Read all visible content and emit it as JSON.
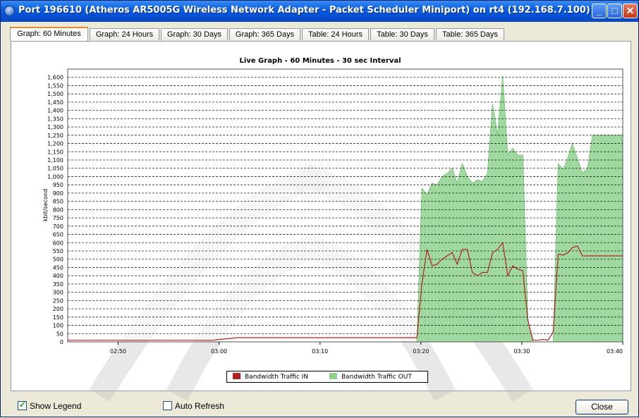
{
  "window": {
    "title": "Port 196610 (Atheros AR5005G Wireless Network Adapter - Packet Scheduler Miniport) on rt4 (192.168.7.100)"
  },
  "tabs": [
    {
      "label": "Graph: 60 Minutes",
      "active": true
    },
    {
      "label": "Graph: 24 Hours",
      "active": false
    },
    {
      "label": "Graph: 30 Days",
      "active": false
    },
    {
      "label": "Graph: 365 Days",
      "active": false
    },
    {
      "label": "Table: 24 Hours",
      "active": false
    },
    {
      "label": "Table: 30 Days",
      "active": false
    },
    {
      "label": "Table: 365 Days",
      "active": false
    }
  ],
  "chart_data": {
    "type": "area",
    "title": "Live Graph - 60 Minutes - 30 sec Interval",
    "ylabel": "kbit/second",
    "xlabel": "",
    "ylim": [
      0,
      1650
    ],
    "yticks": [
      0,
      50,
      100,
      150,
      200,
      250,
      300,
      350,
      400,
      450,
      500,
      550,
      600,
      650,
      700,
      750,
      800,
      850,
      900,
      950,
      1000,
      1050,
      1100,
      1150,
      1200,
      1250,
      1300,
      1350,
      1400,
      1450,
      1500,
      1550,
      1600
    ],
    "yticklabels": [
      "0",
      "50",
      "100",
      "150",
      "200",
      "250",
      "300",
      "350",
      "400",
      "450",
      "500",
      "550",
      "600",
      "650",
      "700",
      "750",
      "800",
      "850",
      "900",
      "950",
      "1,000",
      "1,050",
      "1,100",
      "1,150",
      "1,200",
      "1,250",
      "1,300",
      "1,350",
      "1,400",
      "1,450",
      "1,500",
      "1,550",
      "1,600"
    ],
    "xlim": [
      2.75,
      3.6667
    ],
    "xticks": [
      2.8333,
      3.0,
      3.1667,
      3.3333,
      3.5,
      3.6667
    ],
    "xticklabels": [
      "02:50",
      "03:00",
      "03:10",
      "03:20",
      "03:30",
      "03:40"
    ],
    "grid": true,
    "legend_position": "bottom",
    "series": [
      {
        "name": "Bandwidth Traffic IN",
        "color": "#b22222",
        "style": "line",
        "x": [
          2.75,
          2.99,
          3.0,
          3.03,
          3.3267,
          3.335,
          3.3433,
          3.3517,
          3.36,
          3.3683,
          3.3767,
          3.385,
          3.3933,
          3.4017,
          3.41,
          3.4183,
          3.4267,
          3.435,
          3.4433,
          3.4517,
          3.46,
          3.4683,
          3.4767,
          3.485,
          3.4933,
          3.5017,
          3.51,
          3.5183,
          3.5267,
          3.535,
          3.5433,
          3.5517,
          3.56,
          3.5683,
          3.5767,
          3.5833,
          3.5917,
          3.6,
          3.6083,
          3.6167,
          3.625,
          3.6333,
          3.6417,
          3.6583,
          3.6667
        ],
        "y": [
          10,
          10,
          15,
          25,
          25,
          350,
          560,
          460,
          470,
          500,
          520,
          540,
          470,
          560,
          560,
          420,
          400,
          420,
          420,
          540,
          560,
          600,
          400,
          460,
          440,
          430,
          130,
          10,
          10,
          15,
          10,
          60,
          530,
          525,
          540,
          570,
          580,
          520,
          520,
          520,
          520,
          520,
          520,
          520,
          520
        ]
      },
      {
        "name": "Bandwidth Traffic OUT",
        "color": "#8fd28f",
        "style": "area",
        "x": [
          2.75,
          3.3267,
          3.335,
          3.3433,
          3.3517,
          3.36,
          3.3683,
          3.3767,
          3.385,
          3.3933,
          3.4017,
          3.41,
          3.4183,
          3.4267,
          3.435,
          3.4433,
          3.4517,
          3.46,
          3.4683,
          3.4767,
          3.485,
          3.4933,
          3.5017,
          3.51,
          3.5183,
          3.5267,
          3.535,
          3.5433,
          3.5517,
          3.56,
          3.5683,
          3.5767,
          3.5833,
          3.5917,
          3.6,
          3.6083,
          3.6167,
          3.625,
          3.6333,
          3.6417,
          3.6583,
          3.6667
        ],
        "y": [
          0,
          0,
          930,
          890,
          960,
          950,
          1000,
          1020,
          1050,
          960,
          1080,
          1000,
          960,
          980,
          970,
          1020,
          1440,
          1250,
          1610,
          1130,
          1170,
          1130,
          1130,
          130,
          0,
          0,
          0,
          0,
          0,
          1080,
          1040,
          1120,
          1200,
          1110,
          1020,
          1050,
          1250,
          1250,
          1250,
          1250,
          1250,
          1250
        ]
      }
    ]
  },
  "footer": {
    "show_legend_label": "Show Legend",
    "show_legend_checked": true,
    "auto_refresh_label": "Auto Refresh",
    "auto_refresh_checked": false,
    "close_label": "Close"
  }
}
